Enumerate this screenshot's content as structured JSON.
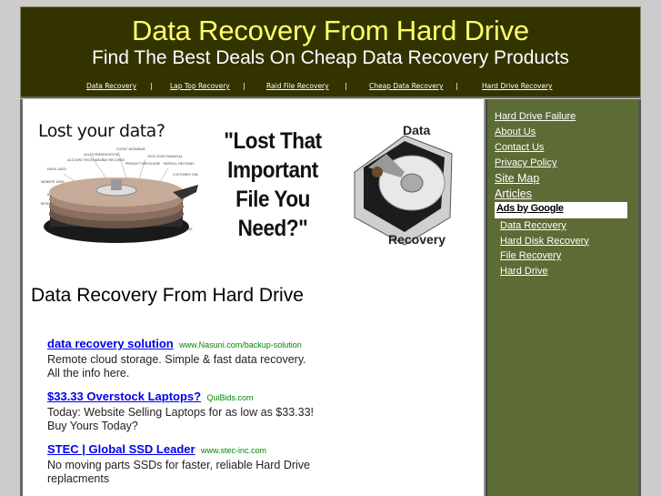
{
  "header": {
    "title": "Data Recovery From Hard Drive",
    "subtitle": "Find The Best Deals On Cheap Data Recovery Products",
    "nav": [
      {
        "label": "Data Recovery"
      },
      {
        "label": "Lap Top Recovery"
      },
      {
        "label": "Raid File Recovery"
      },
      {
        "label": "Cheap Data Recovery"
      },
      {
        "label": "Hard Drive Recovery"
      }
    ],
    "separator": "|"
  },
  "banner": {
    "image1_text": "Lost your data?",
    "image1_icon": "hard-drive-platter-icon",
    "quote": "\"Lost That Important File You Need?\"",
    "image2_top": "Data",
    "image2_bottom": "Recovery",
    "image2_icon": "open-hard-drive-icon"
  },
  "main": {
    "heading": "Data Recovery From Hard Drive",
    "ads": [
      {
        "title": "data recovery solution",
        "url": "www.Nasuni.com/backup-solution",
        "desc": "Remote cloud storage. Simple & fast data recovery. All the info here."
      },
      {
        "title": "$33.33 Overstock Laptops?",
        "url": "QuiBids.com",
        "desc": "Today: Website Selling Laptops for as low as $33.33! Buy Yours Today?"
      },
      {
        "title": "STEC | Global SSD Leader",
        "url": "www.stec-inc.com",
        "desc": "No moving parts SSDs for faster, reliable Hard Drive replacments"
      }
    ]
  },
  "sidebar": {
    "links": [
      {
        "label": "Hard Drive Failure"
      },
      {
        "label": "About Us"
      },
      {
        "label": "Contact Us"
      },
      {
        "label": "Privacy Policy"
      },
      {
        "label": "Site Map"
      },
      {
        "label": "Articles"
      }
    ],
    "ads_label": "Ads by Google",
    "ad_links": [
      {
        "label": "Data Recovery"
      },
      {
        "label": "Hard Disk Recovery"
      },
      {
        "label": "File Recovery"
      },
      {
        "label": "Hard Drive"
      }
    ]
  },
  "colors": {
    "header_bg": "#333300",
    "title": "#ffff66",
    "sidebar_bg": "#5d6b35",
    "ad_link": "#0000ee",
    "ad_url": "#008800"
  }
}
